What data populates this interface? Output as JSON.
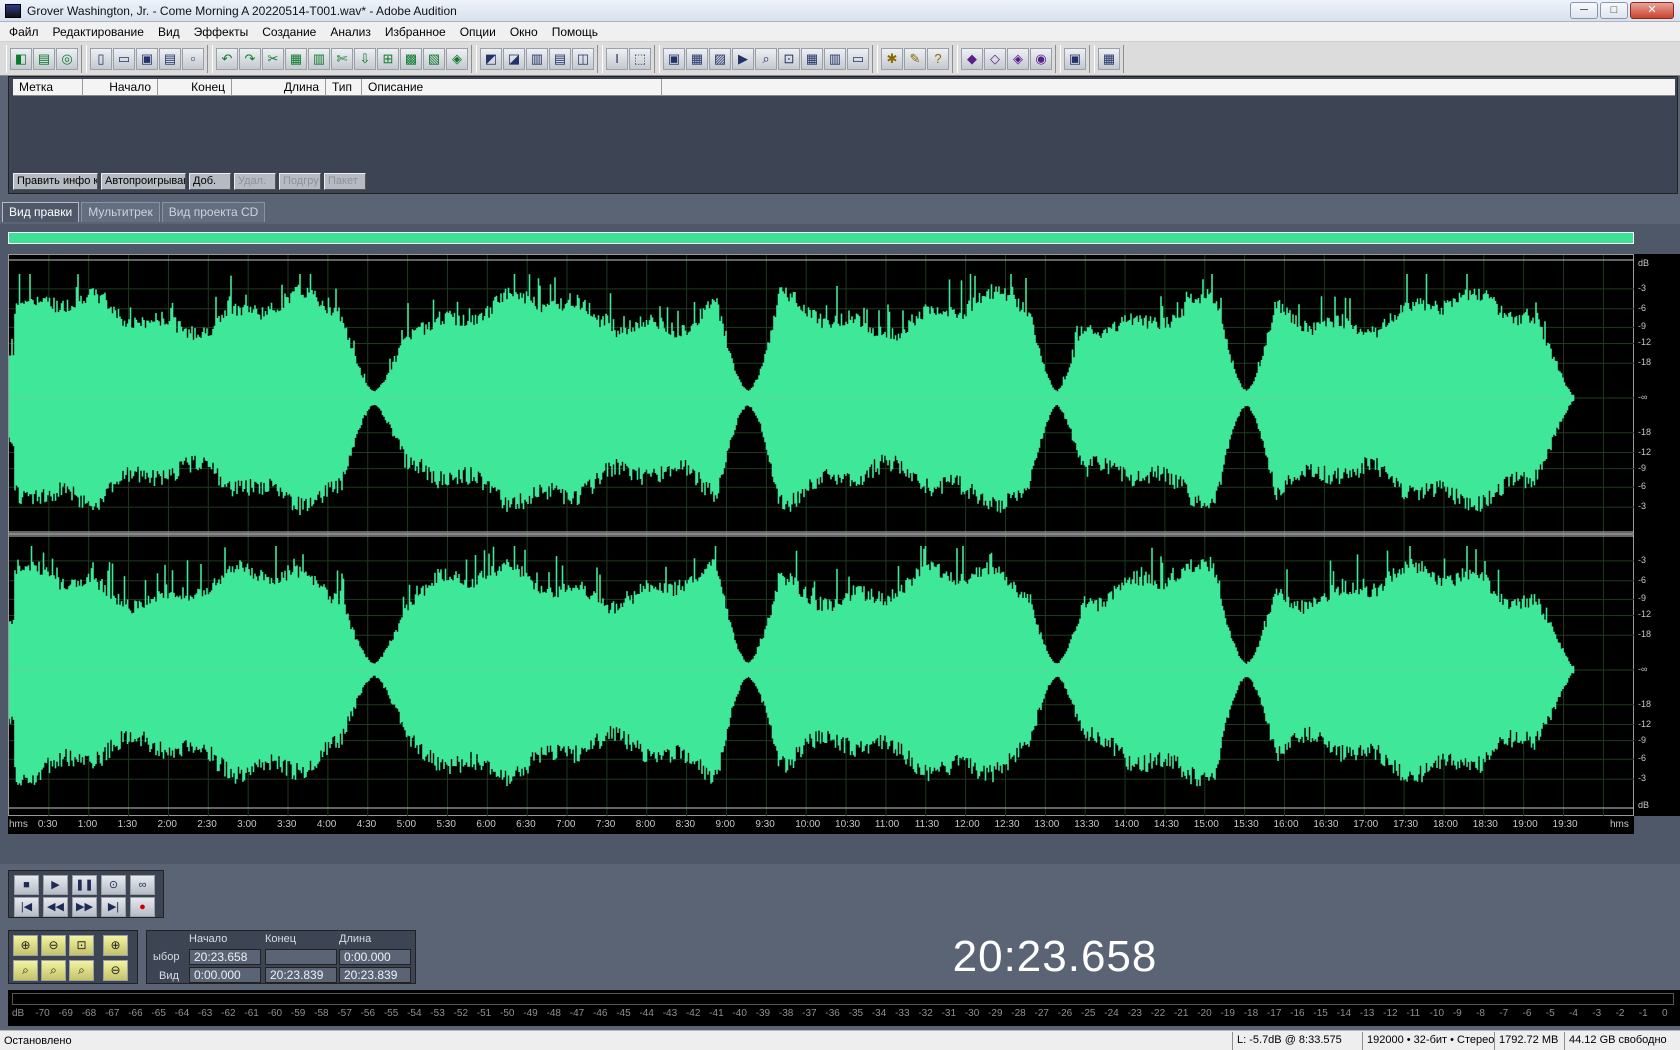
{
  "window": {
    "title": "Grover Washington, Jr. - Come Morning  A 20220514-T001.wav* - Adobe Audition",
    "controls": [
      "─",
      "□",
      "✕"
    ]
  },
  "menu": [
    "Файл",
    "Редактирование",
    "Вид",
    "Эффекты",
    "Создание",
    "Анализ",
    "Избранное",
    "Опции",
    "Окно",
    "Помощь"
  ],
  "toolbar_icons": [
    [
      "waveform-icon",
      "multitrack-icon",
      "cd-icon"
    ],
    [
      "new-file-icon",
      "open-icon",
      "save-icon",
      "save-as-icon",
      "close-file-icon"
    ],
    [
      "undo-icon",
      "redo-icon",
      "cut-icon",
      "copy-icon",
      "paste-icon",
      "trim-icon",
      "mix-paste-icon",
      "crossfade-icon",
      "normalize-icon",
      "amplify-icon",
      "noise-icon"
    ],
    [
      "spectral-icon",
      "phase-icon",
      "frequency-icon",
      "stats-icon",
      "loop-icon"
    ],
    [
      "time-select-icon",
      "marquee-icon"
    ],
    [
      "view-1-icon",
      "view-2-icon",
      "view-3-icon",
      "view-4-icon",
      "view-5-icon",
      "view-6-icon",
      "view-7-icon",
      "view-8-icon",
      "view-9-icon"
    ],
    [
      "tool-1-icon",
      "tool-2-icon",
      "help-icon"
    ],
    [
      "effect-1-icon",
      "effect-2-icon",
      "effect-3-icon",
      "effect-4-icon"
    ],
    [
      "extra-1-icon"
    ],
    [
      "extra-2-icon"
    ]
  ],
  "cue_list": {
    "headers": [
      "Метка",
      "Начало",
      "Конец",
      "Длина",
      "Тип",
      "Описание"
    ],
    "buttons": [
      {
        "label": "Править инфо кн",
        "disabled": false
      },
      {
        "label": "Автопроигрывани",
        "disabled": false
      },
      {
        "label": "Доб.",
        "disabled": false
      },
      {
        "label": "Удал.",
        "disabled": true
      },
      {
        "label": "Подгру",
        "disabled": true
      },
      {
        "label": "Пакет",
        "disabled": true
      }
    ]
  },
  "view_tabs": [
    {
      "label": "Вид правки",
      "active": true
    },
    {
      "label": "Мультитрек",
      "active": false
    },
    {
      "label": "Вид проекта CD",
      "active": false
    }
  ],
  "waveform": {
    "color": "#3ee898",
    "background": "#000000",
    "grid_color": "#1f3a1f"
  },
  "db_scale": {
    "unit_top": "dB",
    "unit_bottom": "dB",
    "left_channel": [
      "-3",
      "-6",
      "-9",
      "-12",
      "-18",
      "-∞",
      "-18",
      "-12",
      "-9",
      "-6",
      "-3"
    ],
    "right_channel": [
      "-3",
      "-6",
      "-9",
      "-12",
      "-18",
      "-∞",
      "-18",
      "-12",
      "-9",
      "-6",
      "-3"
    ]
  },
  "time_ruler": {
    "unit": "hms",
    "labels": [
      "0:30",
      "1:00",
      "1:30",
      "2:00",
      "2:30",
      "3:00",
      "3:30",
      "4:00",
      "4:30",
      "5:00",
      "5:30",
      "6:00",
      "6:30",
      "7:00",
      "7:30",
      "8:00",
      "8:30",
      "9:00",
      "9:30",
      "10:00",
      "10:30",
      "11:00",
      "11:30",
      "12:00",
      "12:30",
      "13:00",
      "13:30",
      "14:00",
      "14:30",
      "15:00",
      "15:30",
      "16:00",
      "16:30",
      "17:00",
      "17:30",
      "18:00",
      "18:30",
      "19:00",
      "19:30"
    ]
  },
  "transport": {
    "row1": [
      {
        "name": "stop-icon",
        "glyph": "■"
      },
      {
        "name": "play-icon",
        "glyph": "▶"
      },
      {
        "name": "pause-icon",
        "glyph": "❚❚"
      },
      {
        "name": "play-to-end-icon",
        "glyph": "⊙"
      },
      {
        "name": "loop-icon",
        "glyph": "∞"
      }
    ],
    "row2": [
      {
        "name": "go-to-start-icon",
        "glyph": "|◀"
      },
      {
        "name": "rewind-icon",
        "glyph": "◀◀"
      },
      {
        "name": "fast-forward-icon",
        "glyph": "▶▶"
      },
      {
        "name": "go-to-end-icon",
        "glyph": "▶|"
      },
      {
        "name": "record-icon",
        "glyph": "●"
      }
    ]
  },
  "zoom": {
    "buttons": [
      "zoom-in-horizontal-icon",
      "zoom-out-horizontal-icon",
      "zoom-full-icon",
      "zoom-in-vertical-icon",
      "zoom-left-icon",
      "zoom-right-icon",
      "zoom-selection-icon",
      "zoom-out-vertical-icon"
    ]
  },
  "selection": {
    "headers": [
      "Начало",
      "Конец",
      "Длина"
    ],
    "row_labels": [
      "ыбор",
      "Вид"
    ],
    "sel_start": "20:23.658",
    "sel_end": "",
    "sel_length": "0:00.000",
    "view_start": "0:00.000",
    "view_end": "20:23.839",
    "view_length": "20:23.839"
  },
  "current_time": "20:23.658",
  "level_meter": {
    "labels": [
      "dB",
      "-70",
      "-69",
      "-68",
      "-67",
      "-66",
      "-65",
      "-64",
      "-63",
      "-62",
      "-61",
      "-60",
      "-59",
      "-58",
      "-57",
      "-56",
      "-55",
      "-54",
      "-53",
      "-52",
      "-51",
      "-50",
      "-49",
      "-48",
      "-47",
      "-46",
      "-45",
      "-44",
      "-43",
      "-42",
      "-41",
      "-40",
      "-39",
      "-38",
      "-37",
      "-36",
      "-35",
      "-34",
      "-33",
      "-32",
      "-31",
      "-30",
      "-29",
      "-28",
      "-27",
      "-26",
      "-25",
      "-24",
      "-23",
      "-22",
      "-21",
      "-20",
      "-19",
      "-18",
      "-17",
      "-16",
      "-15",
      "-14",
      "-13",
      "-12",
      "-11",
      "-10",
      "-9",
      "-8",
      "-7",
      "-6",
      "-5",
      "-4",
      "-3",
      "-2",
      "-1",
      "0"
    ]
  },
  "status": {
    "state": "Остановлено",
    "cursor": "L: -5.7dB @   8:33.575",
    "format": "192000 • 32-бит • Стерео",
    "file_size": "1792.72 MB",
    "free_space": "44.12 GB свободно"
  }
}
